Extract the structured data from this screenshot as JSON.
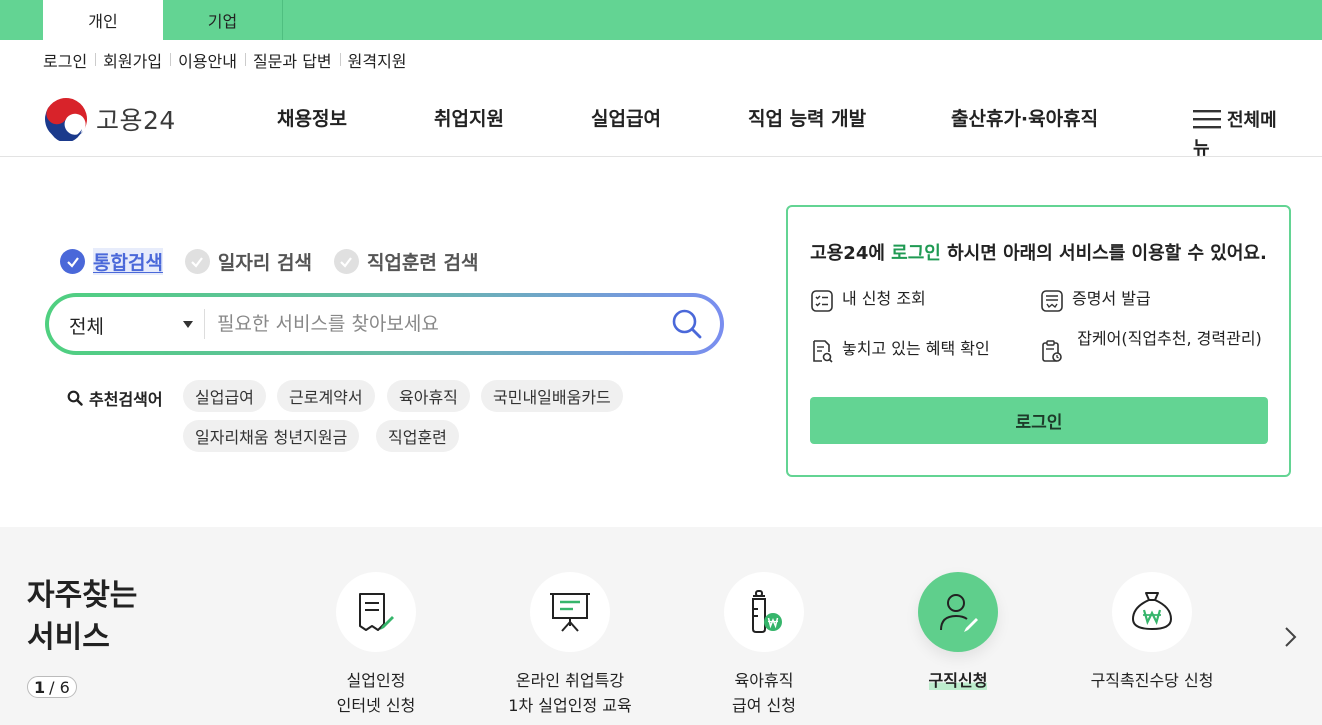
{
  "top_tabs": [
    {
      "label": "개인"
    },
    {
      "label": "기업"
    }
  ],
  "util_links": [
    "로그인",
    "회원가입",
    "이용안내",
    "질문과 답변",
    "원격지원"
  ],
  "logo": {
    "text": "고용24"
  },
  "gnb": [
    "채용정보",
    "취업지원",
    "실업급여",
    "직업 능력 개발",
    "출산휴가·육아휴직"
  ],
  "all_menu": "전체메뉴",
  "search": {
    "options": [
      "통합검색",
      "일자리 검색",
      "직업훈련 검색"
    ],
    "category": "전체",
    "placeholder": "필요한 서비스를 찾아보세요"
  },
  "keywords": {
    "label": "추천검색어",
    "items": [
      "실업급여",
      "근로계약서",
      "육아휴직",
      "국민내일배움카드",
      "일자리채움 청년지원금",
      "직업훈련"
    ]
  },
  "login_box": {
    "title_pre": "고용24에 ",
    "title_hl": "로그인",
    "title_post": " 하시면 아래의 서비스를 이용할 수 있어요.",
    "items": [
      "내 신청 조회",
      "증명서 발급",
      "놓치고 있는 혜택 확인",
      "잡케어(직업추천, 경력관리)"
    ],
    "button": "로그인"
  },
  "frequent": {
    "title": "자주찾는\n서비스",
    "page_current": "1",
    "page_sep": "/",
    "page_total": "6",
    "services": [
      {
        "label": "실업인정\n인터넷 신청"
      },
      {
        "label": "온라인 취업특강\n1차 실업인정 교육"
      },
      {
        "label": "육아휴직\n급여 신청"
      },
      {
        "label": "구직신청"
      },
      {
        "label": "구직촉진수당 신청"
      }
    ]
  },
  "colors": {
    "brand_green": "#63d493",
    "accent_blue": "#4a68d9"
  }
}
